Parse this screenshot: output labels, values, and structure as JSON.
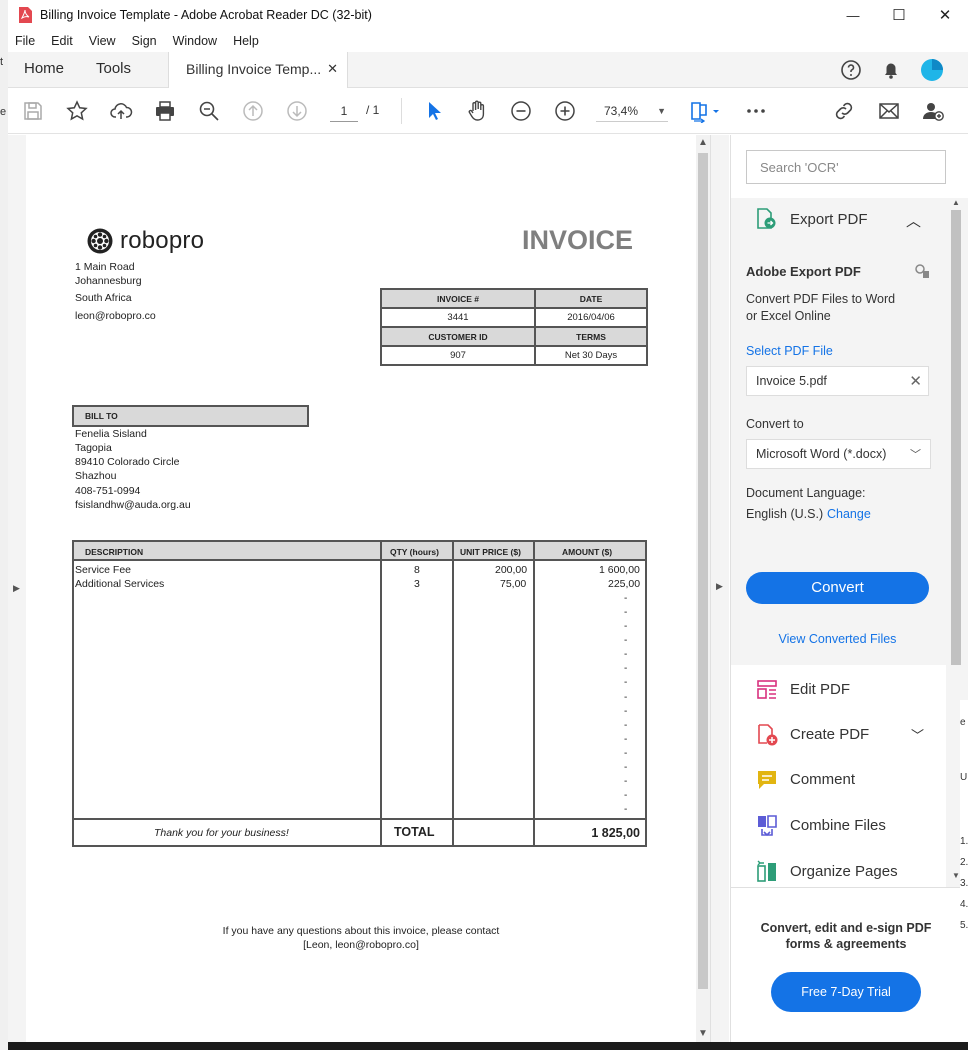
{
  "window": {
    "title": "Billing Invoice Template - Adobe Acrobat Reader DC (32-bit)",
    "minimize": "—",
    "maximize": "☐",
    "close": "✕"
  },
  "menu": [
    "File",
    "Edit",
    "View",
    "Sign",
    "Window",
    "Help"
  ],
  "tabs": {
    "home": "Home",
    "tools": "Tools",
    "document": "Billing Invoice Temp...",
    "close": "✕"
  },
  "toolbar": {
    "page_current": "1",
    "page_total": "/ 1",
    "zoom": "73,4%"
  },
  "invoice": {
    "logo_text": "robopro",
    "title": "INVOICE",
    "company_address": [
      "1 Main Road",
      "Johannesburg",
      "South Africa",
      "leon@robopro.co"
    ],
    "meta_headers": [
      "INVOICE #",
      "DATE",
      "CUSTOMER ID",
      "TERMS"
    ],
    "invoice_number": "3441",
    "date": "2016/04/06",
    "customer_id": "907",
    "terms": "Net 30 Days",
    "bill_to_label": "BILL TO",
    "bill_to": [
      "Fenelia Sisland",
      "Tagopia",
      "89410 Colorado Circle",
      "Shazhou",
      "408-751-0994",
      "fsislandhw@auda.org.au"
    ],
    "columns": [
      "DESCRIPTION",
      "QTY (hours)",
      "UNIT PRICE ($)",
      "AMOUNT ($)"
    ],
    "items": [
      {
        "description": "Service Fee",
        "qty": "8",
        "unit_price": "200,00",
        "amount": "1 600,00"
      },
      {
        "description": "Additional Services",
        "qty": "3",
        "unit_price": "75,00",
        "amount": "225,00"
      }
    ],
    "empty_amount": "-",
    "thanks": "Thank you for your business!",
    "total_label": "TOTAL",
    "total": "1 825,00",
    "footer_line1": "If you have any questions about this invoice, please contact",
    "footer_line2": "[Leon, leon@robopro.co]"
  },
  "panel": {
    "search_placeholder": "Search 'OCR'",
    "export_title": "Export PDF",
    "adobe_export_title": "Adobe Export PDF",
    "description": [
      "Convert PDF Files to Word",
      "or Excel Online"
    ],
    "select_file_label": "Select PDF File",
    "file_name": "Invoice 5.pdf",
    "file_clear": "✕",
    "convert_to_label": "Convert to",
    "convert_to_value": "Microsoft Word (*.docx)",
    "doc_lang_label": "Document Language:",
    "doc_lang_value": "English (U.S.)",
    "change_link": "Change",
    "convert_button": "Convert",
    "view_converted": "View Converted Files",
    "tools": [
      {
        "label": "Edit PDF",
        "icon": "edit-pdf-icon",
        "color": "#d8317f"
      },
      {
        "label": "Create PDF",
        "icon": "create-pdf-icon",
        "color": "#e34850"
      },
      {
        "label": "Comment",
        "icon": "comment-icon",
        "color": "#e2b511"
      },
      {
        "label": "Combine Files",
        "icon": "combine-files-icon",
        "color": "#5c5cd6"
      },
      {
        "label": "Organize Pages",
        "icon": "organize-pages-icon",
        "color": "#2d9d78"
      }
    ],
    "promo": "Convert, edit and e-sign PDF forms & agreements",
    "trial_button": "Free 7-Day Trial"
  },
  "edge_text": {
    "left": [
      "t",
      "e"
    ],
    "right": [
      "e",
      "U",
      "1.",
      "2.",
      "3.",
      "4.",
      "5."
    ]
  },
  "colors": {
    "accent": "#1473e6",
    "header_gray": "#d9d9d9",
    "invoice_title": "#7f7f7f"
  }
}
